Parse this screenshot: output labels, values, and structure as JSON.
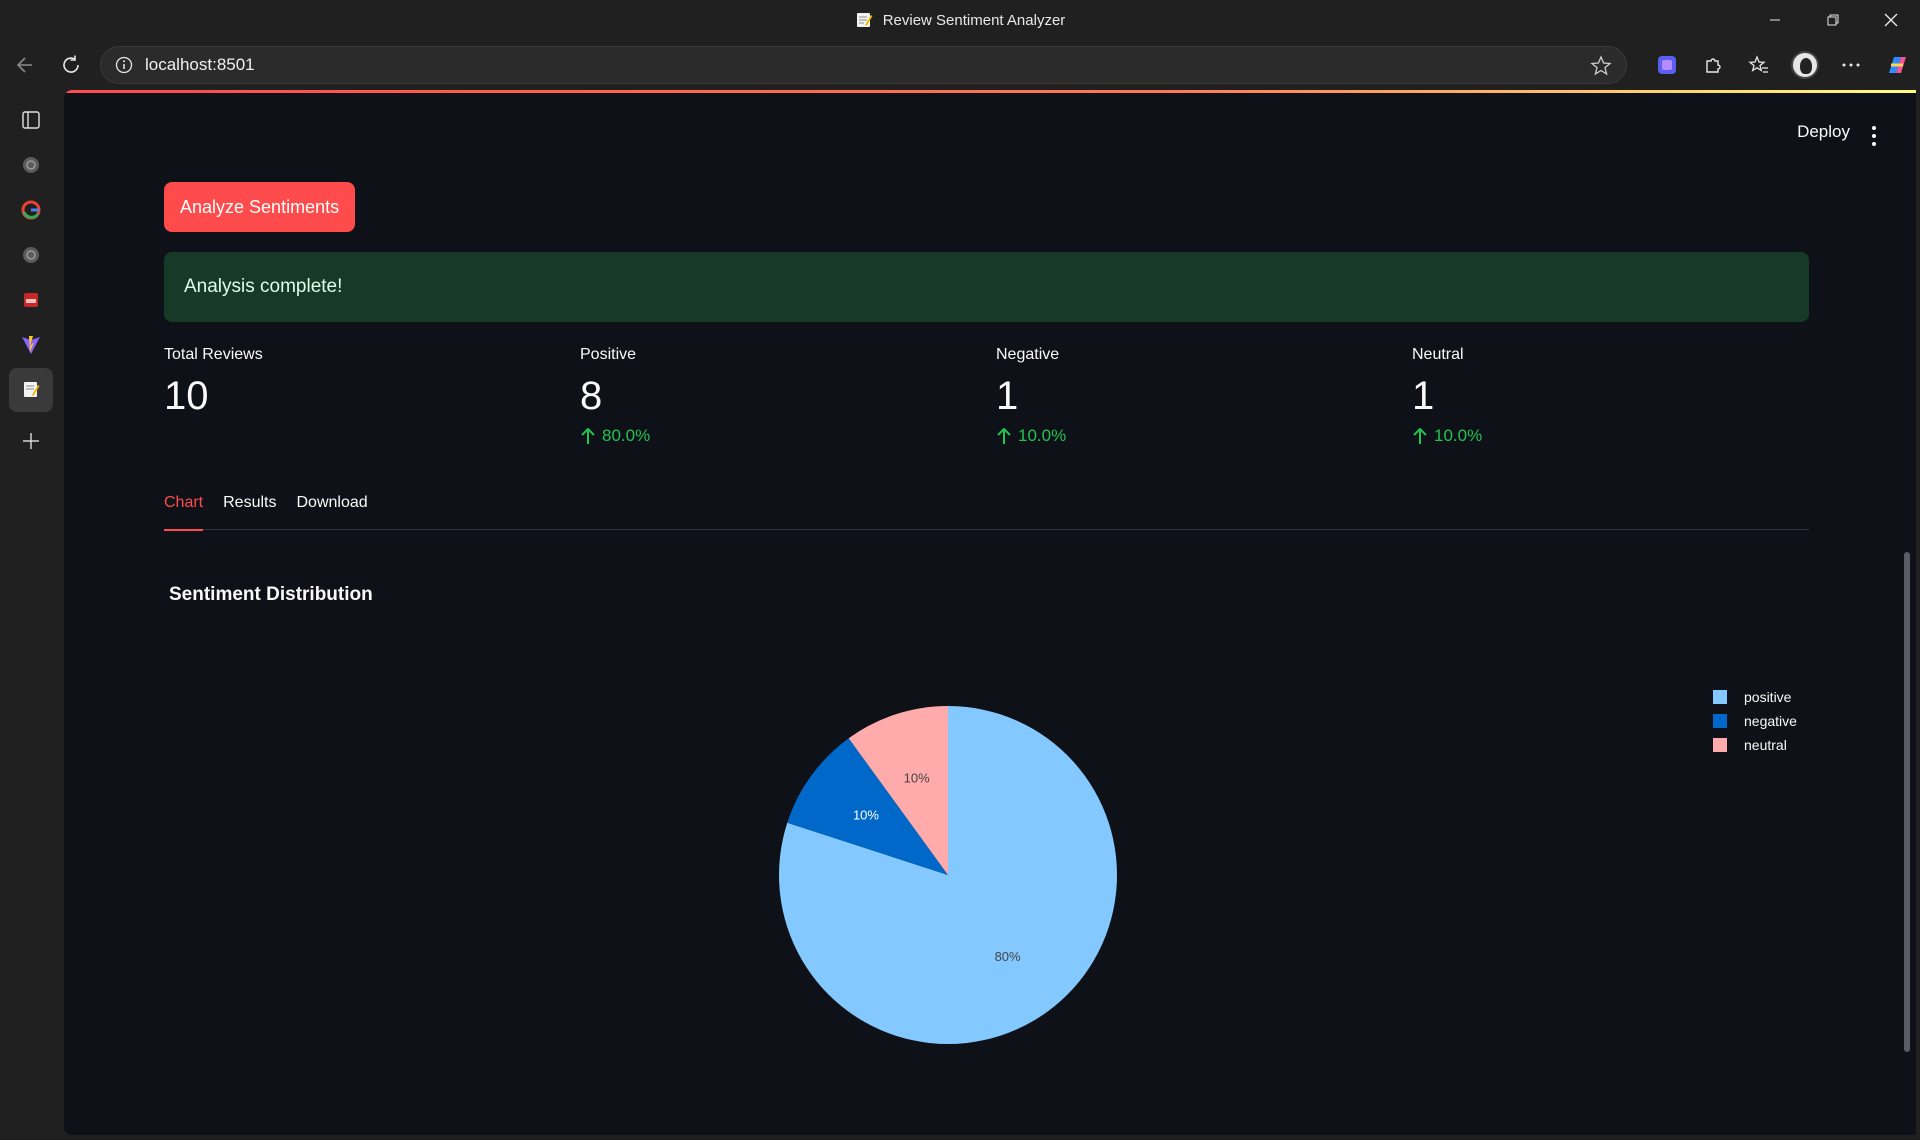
{
  "window": {
    "title": "Review Sentiment Analyzer"
  },
  "browser": {
    "url": "localhost:8501"
  },
  "header": {
    "deploy_label": "Deploy"
  },
  "actions": {
    "analyze_label": "Analyze Sentiments"
  },
  "alert": {
    "message": "Analysis complete!"
  },
  "metrics": [
    {
      "label": "Total Reviews",
      "value": "10",
      "delta": ""
    },
    {
      "label": "Positive",
      "value": "8",
      "delta": "80.0%"
    },
    {
      "label": "Negative",
      "value": "1",
      "delta": "10.0%"
    },
    {
      "label": "Neutral",
      "value": "1",
      "delta": "10.0%"
    }
  ],
  "tabs": [
    {
      "label": "Chart",
      "active": true
    },
    {
      "label": "Results",
      "active": false
    },
    {
      "label": "Download",
      "active": false
    }
  ],
  "colors": {
    "accent": "#ff4b4b",
    "success_bg": "#173928",
    "delta_green": "#21c354"
  },
  "chart_data": {
    "type": "pie",
    "title": "Sentiment Distribution",
    "categories": [
      "positive",
      "negative",
      "neutral"
    ],
    "values": [
      80,
      10,
      10
    ],
    "labels": [
      "80%",
      "10%",
      "10%"
    ],
    "colors": [
      "#83c9ff",
      "#0068c9",
      "#ffabab"
    ],
    "legend": "top-right"
  }
}
